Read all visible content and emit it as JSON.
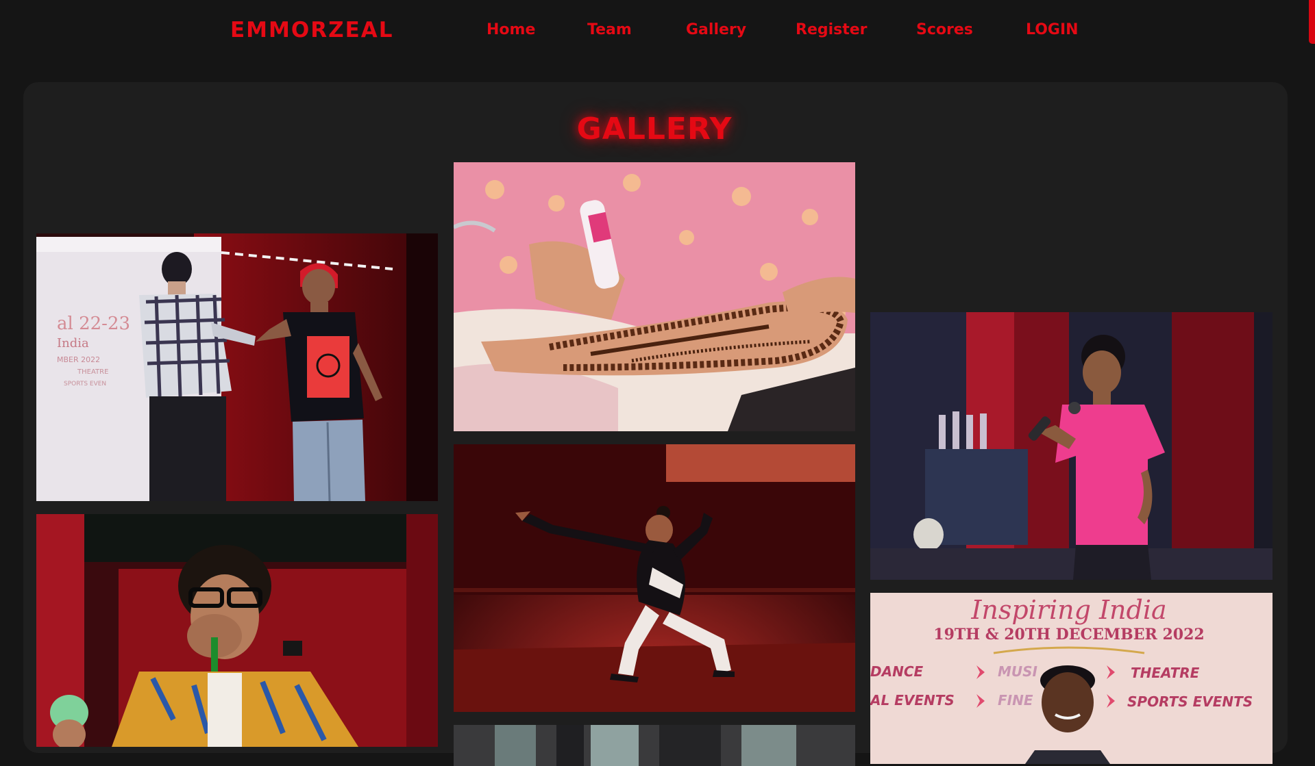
{
  "nav": {
    "brand": "EMMORZEAL",
    "links": [
      "Home",
      "Team",
      "Gallery",
      "Register",
      "Scores",
      "LOGIN"
    ]
  },
  "gallery": {
    "title": "GALLERY",
    "banner": {
      "heading": "Inspiring India",
      "dates": "19TH & 20TH DECEMBER 2022",
      "categories_left": [
        "DANCE",
        "AL EVENTS"
      ],
      "categories_mid": [
        "MUSI",
        "FINE"
      ],
      "categories_right": [
        "THEATRE",
        "SPORTS EVENTS"
      ]
    },
    "stage_poster": {
      "line1": "al 22-23",
      "line2": "India",
      "line3": "MBER 2022",
      "item1": "THEATRE",
      "item2": "SPORTS EVEN"
    }
  },
  "colors": {
    "accent": "#e50914",
    "page_bg": "#151515",
    "panel_bg": "#1e1e1e"
  }
}
